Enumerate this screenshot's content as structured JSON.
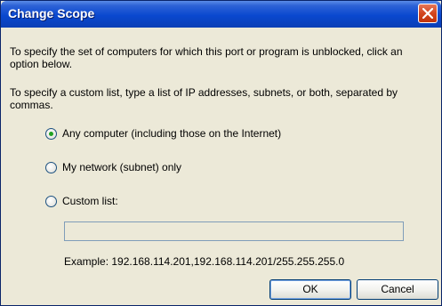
{
  "window": {
    "title": "Change Scope",
    "close_icon": "close-icon"
  },
  "instructions": {
    "intro": "To specify the set of computers for which this port or program is unblocked, click an option below.",
    "custom_help": "To specify a custom list, type a list of IP addresses, subnets, or both, separated by commas."
  },
  "options": [
    {
      "label": "Any computer (including those on the Internet)",
      "selected": true
    },
    {
      "label": "My network (subnet) only",
      "selected": false
    },
    {
      "label": "Custom list:",
      "selected": false
    }
  ],
  "custom_list": {
    "value": "",
    "example": "Example: 192.168.114.201,192.168.114.201/255.255.255.0"
  },
  "buttons": {
    "ok": "OK",
    "cancel": "Cancel"
  },
  "colors": {
    "titlebar": "#0a48cf",
    "dialog_background": "#ece9d8",
    "radio_selected": "#21a121"
  }
}
